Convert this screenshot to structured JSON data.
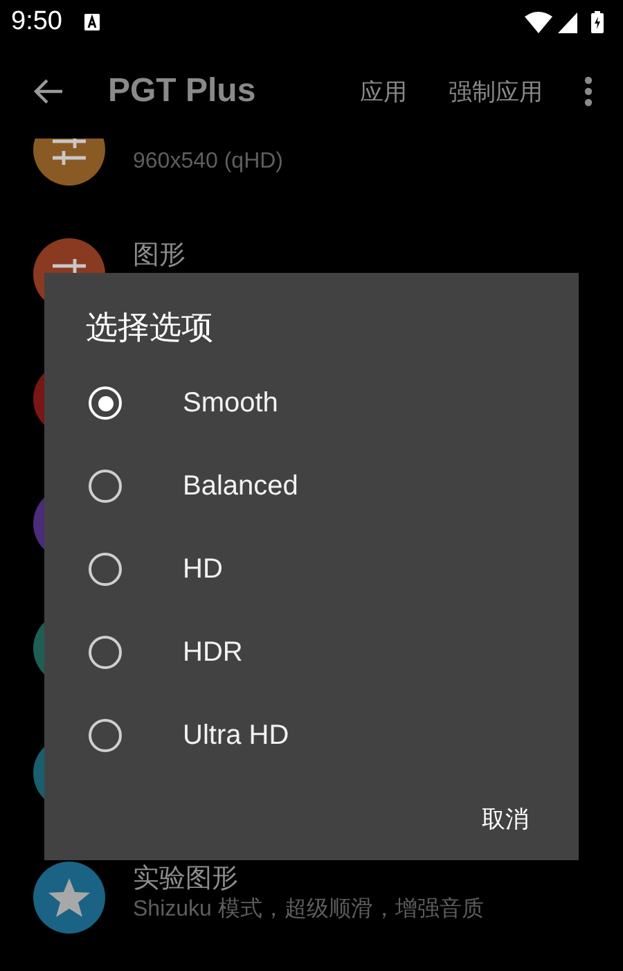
{
  "status_bar": {
    "time": "9:50"
  },
  "app_bar": {
    "title": "PGT Plus",
    "actions": [
      "应用",
      "强制应用"
    ]
  },
  "settings_list": [
    {
      "kind": "sliders",
      "color": "#8a5a24",
      "subtitle": "960x540 (qHD)"
    },
    {
      "kind": "sliders",
      "color": "#8a3a20",
      "title": "图形"
    },
    {
      "kind": "plain",
      "color": "#7a1616"
    },
    {
      "kind": "plain",
      "color": "#4a2c78"
    },
    {
      "kind": "plain",
      "color": "#1d5e55"
    },
    {
      "kind": "plain",
      "color": "#1a5f6e"
    },
    {
      "kind": "star",
      "color": "#1b6384",
      "title": "实验图形",
      "subtitle": "Shizuku 模式，超级顺滑，增强音质"
    }
  ],
  "dialog": {
    "title": "选择选项",
    "options": [
      {
        "label": "Smooth",
        "selected": true
      },
      {
        "label": "Balanced",
        "selected": false
      },
      {
        "label": "HD",
        "selected": false
      },
      {
        "label": "HDR",
        "selected": false
      },
      {
        "label": "Ultra HD",
        "selected": false
      }
    ],
    "cancel": "取消"
  }
}
